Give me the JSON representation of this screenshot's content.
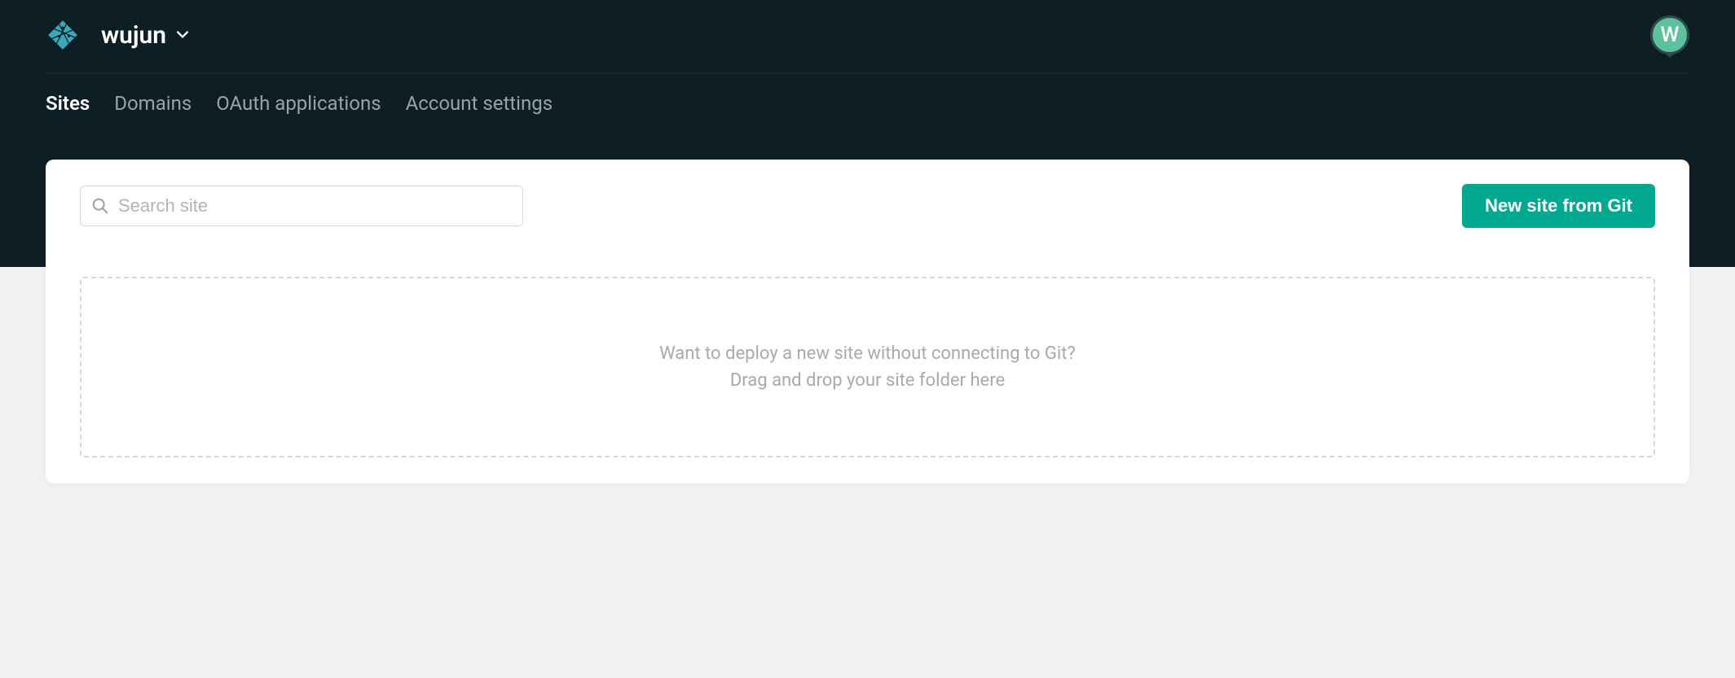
{
  "header": {
    "team_name": "wujun",
    "avatar_initial": "W"
  },
  "nav": {
    "tabs": [
      {
        "label": "Sites",
        "active": true
      },
      {
        "label": "Domains",
        "active": false
      },
      {
        "label": "OAuth applications",
        "active": false
      },
      {
        "label": "Account settings",
        "active": false
      }
    ]
  },
  "search": {
    "placeholder": "Search site",
    "value": ""
  },
  "actions": {
    "new_site_button": "New site from Git"
  },
  "dropzone": {
    "line1": "Want to deploy a new site without connecting to Git?",
    "line2": "Drag and drop your site folder here"
  },
  "colors": {
    "header_bg": "#0e1e25",
    "accent": "#00a88f",
    "avatar_bg": "#5cc29b"
  }
}
